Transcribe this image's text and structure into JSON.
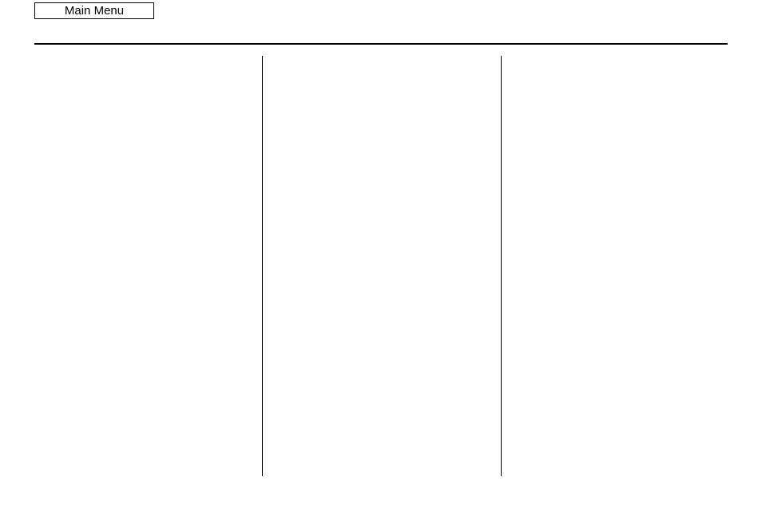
{
  "header": {
    "main_menu_label": "Main Menu"
  },
  "columns": {
    "col1": "",
    "col2": "",
    "col3": ""
  }
}
